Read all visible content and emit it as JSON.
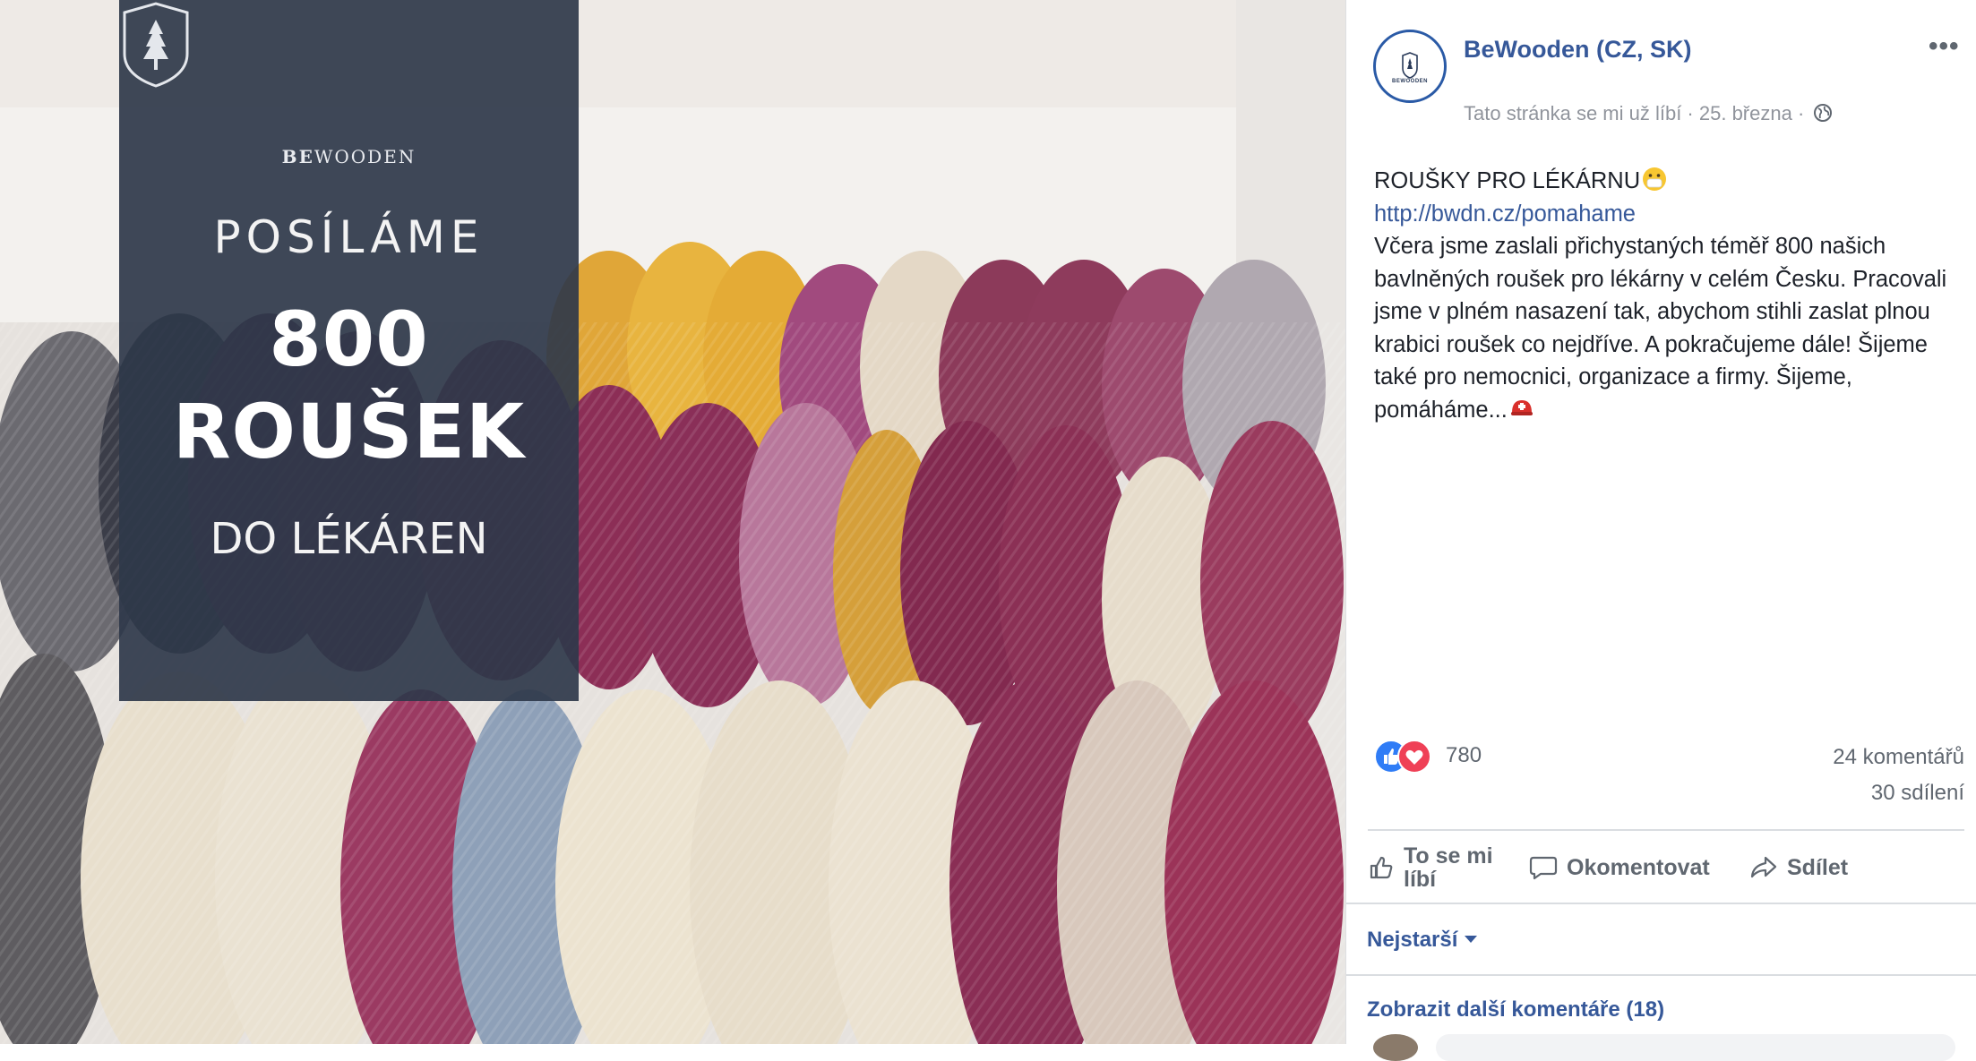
{
  "photo": {
    "alt": "",
    "overlay": {
      "brand_bold": "BE",
      "brand_rest": "WOODEN",
      "line1": "POSÍLÁME",
      "line2": "800",
      "line3": "ROUŠEK",
      "line4": "DO LÉKÁREN"
    }
  },
  "post": {
    "avatar_text": "BEWOODEN",
    "page_name": "BeWooden (CZ, SK)",
    "more_label": "•••",
    "meta": "Tato stránka se mi už líbí · 25. března ·",
    "title": "ROUŠKY PRO LÉKÁRNU",
    "link": "http://bwdn.cz/pomahame",
    "body": "Včera jsme zaslali přichystaných téměř 800 našich bavlněných roušek pro lékárny v celém Česku. Pracovali jsme v plném nasazení tak, abychom stihli zaslat plnou krabici roušek co nejdříve. A pokračujeme dále! Šijeme také pro nemocnici, organizace a firmy. Šijeme, pomáháme..."
  },
  "stats": {
    "reactions": "780",
    "comments": "24 komentářů",
    "shares": "30 sdílení"
  },
  "actions": {
    "like": "To se mi líbí",
    "comment": "Okomentovat",
    "share": "Sdílet"
  },
  "comments": {
    "sort_label": "Nejstarší",
    "more_label": "Zobrazit další komentáře (18)"
  }
}
